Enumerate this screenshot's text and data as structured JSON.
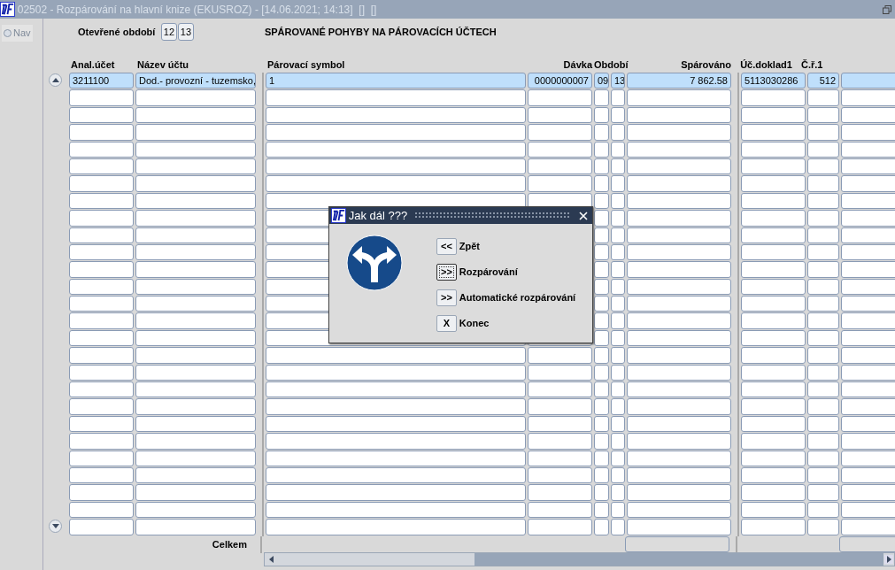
{
  "window": {
    "title": "02502 - Rozpárování na hlavní knize (EKUSROZ) - [14.06.2021; 14:13]  []  []"
  },
  "sidebar": {
    "nav_label": "Nav",
    "nav_selected": false
  },
  "period": {
    "label": "Otevřené období",
    "values": [
      "12",
      "13"
    ]
  },
  "section_heading": "SPÁROVANÉ POHYBY NA PÁROVACÍCH ÚČTECH",
  "table": {
    "columns": [
      "Anal.účet",
      "Název účtu",
      "Párovací symbol",
      "Dávka",
      "Období",
      "Spárováno",
      "Úč.doklad1",
      "Č.ř.1"
    ],
    "rows": [
      {
        "selected": true,
        "cells": [
          "3211100",
          "Dod.- provozní - tuzemsko,",
          "1",
          "0000000007",
          [
            "09",
            "13"
          ],
          "7 862.58",
          "5113030286",
          "512"
        ]
      }
    ],
    "footer_label": "Celkem"
  },
  "dialog": {
    "title": "Jak dál ???",
    "buttons": [
      {
        "key": "<<",
        "label": "Zpět",
        "focused": false
      },
      {
        "key": ">>",
        "label": "Rozpárování",
        "focused": true
      },
      {
        "key": ">>",
        "label": "Automatické rozpárování",
        "focused": false
      },
      {
        "key": "X",
        "label": "Konec",
        "focused": false
      }
    ]
  }
}
